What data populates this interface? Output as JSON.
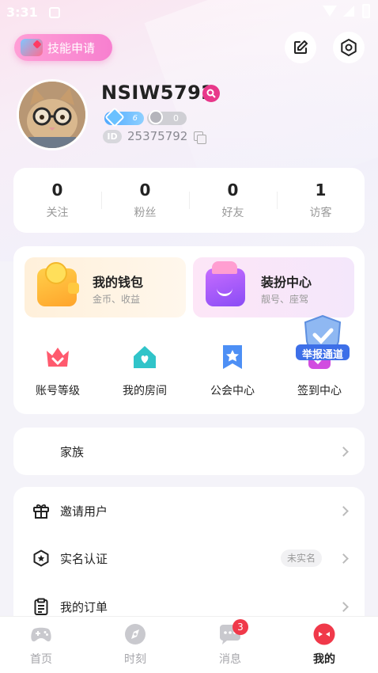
{
  "status_bar": {
    "time": "3:31"
  },
  "header": {
    "skill_apply_label": "技能申请"
  },
  "profile": {
    "username": "NSIW5792",
    "level": "6",
    "charm": "0",
    "id_label": "ID",
    "id_value": "25375792"
  },
  "stats": [
    {
      "value": "0",
      "label": "关注"
    },
    {
      "value": "0",
      "label": "粉丝"
    },
    {
      "value": "0",
      "label": "好友"
    },
    {
      "value": "1",
      "label": "访客"
    }
  ],
  "promos": {
    "wallet": {
      "title": "我的钱包",
      "subtitle": "金币、收益"
    },
    "dress": {
      "title": "装扮中心",
      "subtitle": "靓号、座驾"
    }
  },
  "features": [
    {
      "label": "账号等级",
      "icon": "crown-icon"
    },
    {
      "label": "我的房间",
      "icon": "house-icon"
    },
    {
      "label": "公会中心",
      "icon": "guild-flag-icon"
    },
    {
      "label": "签到中心",
      "icon": "checkin-icon"
    }
  ],
  "report_badge": {
    "label": "举报通道"
  },
  "family": {
    "label": "家族"
  },
  "menu": [
    {
      "label": "邀请用户",
      "icon": "gift-icon"
    },
    {
      "label": "实名认证",
      "icon": "verify-icon",
      "tag": "未实名"
    },
    {
      "label": "我的订单",
      "icon": "clipboard-icon"
    }
  ],
  "nav": [
    {
      "label": "首页",
      "icon": "gamepad-icon"
    },
    {
      "label": "时刻",
      "icon": "compass-icon"
    },
    {
      "label": "消息",
      "icon": "chat-icon",
      "badge": "3"
    },
    {
      "label": "我的",
      "icon": "profile-icon",
      "active": true
    }
  ],
  "colors": {
    "accent": "#e8388a",
    "pill": "#f77fcf",
    "badge": "#f0394a"
  }
}
